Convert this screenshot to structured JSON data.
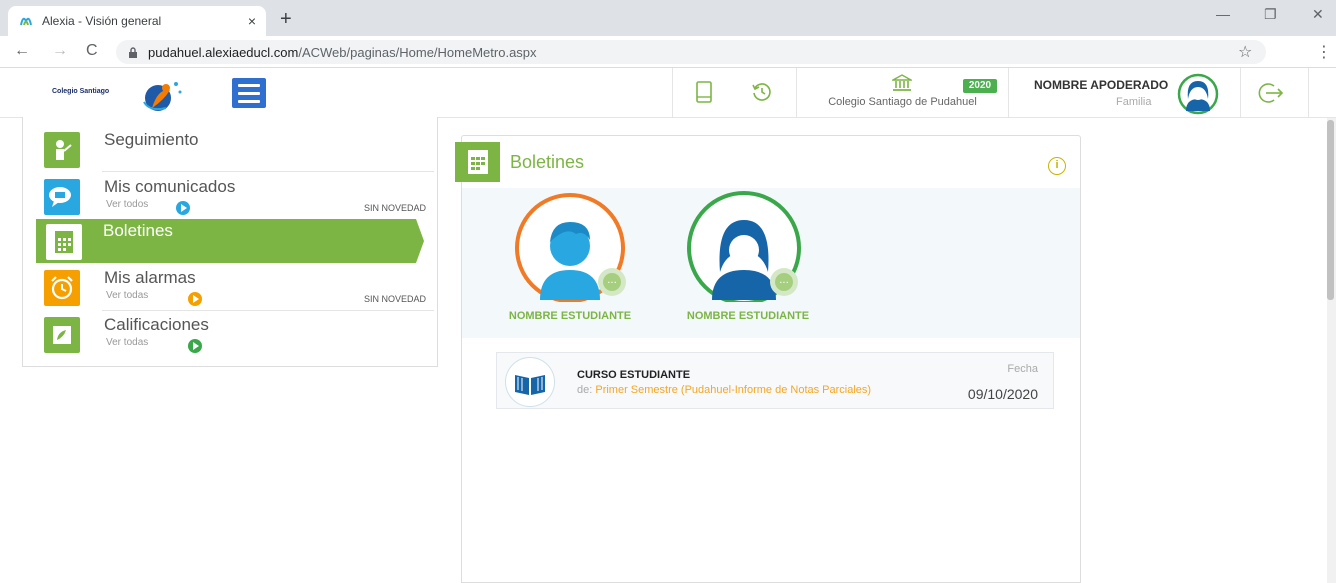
{
  "browser": {
    "tab_title": "Alexia - Visión general",
    "close_tab": "×",
    "new_tab": "+",
    "url_host": "pudahuel.alexiaeducl.com",
    "url_path": "/ACWeb/paginas/Home/HomeMetro.aspx",
    "back": "←",
    "forward": "→",
    "reload": "C",
    "star": "☆",
    "menu": "⋮",
    "minimize": "—",
    "restore": "❐",
    "close": "✕"
  },
  "header": {
    "logo_text": "Colegio Santiago",
    "school_name": "Colegio Santiago de Pudahuel",
    "year": "2020",
    "guardian_name": "NOMBRE APODERADO",
    "guardian_role": "Familia"
  },
  "sidebar": {
    "items": [
      {
        "label": "Seguimiento",
        "icon": "tracking-icon",
        "color": "#7db544"
      },
      {
        "label": "Mis comunicados",
        "sub": "Ver todos",
        "status": "SIN NOVEDAD",
        "icon": "chat-icon",
        "color": "#29a7e1"
      },
      {
        "label": "Boletines",
        "icon": "report-icon",
        "color": "#7db544",
        "active": true
      },
      {
        "label": "Mis alarmas",
        "sub": "Ver todas",
        "status": "SIN NOVEDAD",
        "icon": "alarm-icon",
        "color": "#f5a000"
      },
      {
        "label": "Calificaciones",
        "sub": "Ver todas",
        "icon": "grades-icon",
        "color": "#7db544"
      }
    ]
  },
  "main": {
    "title": "Boletines",
    "info": "i",
    "students": [
      {
        "name": "NOMBRE ESTUDIANTE",
        "ring": "#f07a26",
        "gender": "boy"
      },
      {
        "name": "NOMBRE ESTUDIANTE",
        "ring": "#3aa84a",
        "gender": "girl"
      }
    ],
    "record": {
      "course": "CURSO ESTUDIANTE",
      "de_label": "de:",
      "period": "Primer Semestre (Pudahuel-Informe de Notas Parciales)",
      "fecha_label": "Fecha",
      "fecha": "09/10/2020"
    }
  },
  "colors": {
    "accent_green": "#7db544",
    "blue": "#29a7e1",
    "orange": "#f5a000"
  }
}
